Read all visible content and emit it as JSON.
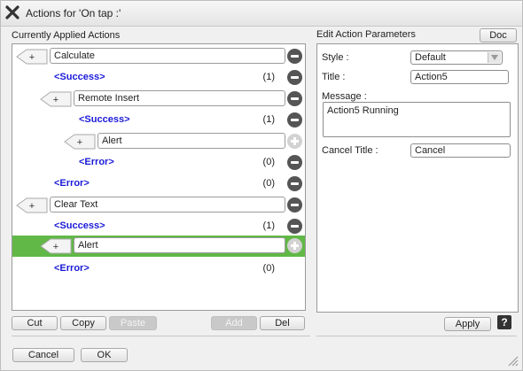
{
  "window": {
    "title": "Actions for 'On tap :'"
  },
  "left_panel": {
    "label": "Currently Applied Actions",
    "rows": [
      {
        "kind": "action",
        "name": "Calculate"
      },
      {
        "kind": "branch",
        "label": "<Success>",
        "count": "(1)"
      },
      {
        "kind": "action",
        "name": "Remote Insert"
      },
      {
        "kind": "branch",
        "label": "<Success>",
        "count": "(1)"
      },
      {
        "kind": "action",
        "name": "Alert"
      },
      {
        "kind": "branch",
        "label": "<Error>",
        "count": "(0)"
      },
      {
        "kind": "branch",
        "label": "<Error>",
        "count": "(0)"
      },
      {
        "kind": "action",
        "name": "Clear Text"
      },
      {
        "kind": "branch",
        "label": "<Success>",
        "count": "(1)"
      },
      {
        "kind": "action",
        "name": "Alert",
        "selected": true
      },
      {
        "kind": "branch",
        "label": "<Error>",
        "count": "(0)"
      }
    ],
    "expander_symbol": "+"
  },
  "bottom_buttons": {
    "cut": "Cut",
    "copy": "Copy",
    "paste": "Paste",
    "add": "Add",
    "del": "Del",
    "cancel": "Cancel",
    "ok": "OK"
  },
  "right_panel": {
    "label": "Edit Action Parameters",
    "doc_button": "Doc",
    "style_label": "Style :",
    "style_value": "Default",
    "title_label": "Title :",
    "title_value": "Action5",
    "message_label": "Message :",
    "message_value": "Action5 Running",
    "cancel_title_label": "Cancel Title :",
    "cancel_title_value": "Cancel",
    "apply_button": "Apply",
    "help_glyph": "?"
  },
  "colors": {
    "selection": "#62b847",
    "branch_text": "#1a1ad8"
  },
  "icons": [
    "close-icon",
    "expander-icon",
    "remove-icon",
    "add-icon",
    "help-icon",
    "resize-grip-icon"
  ]
}
